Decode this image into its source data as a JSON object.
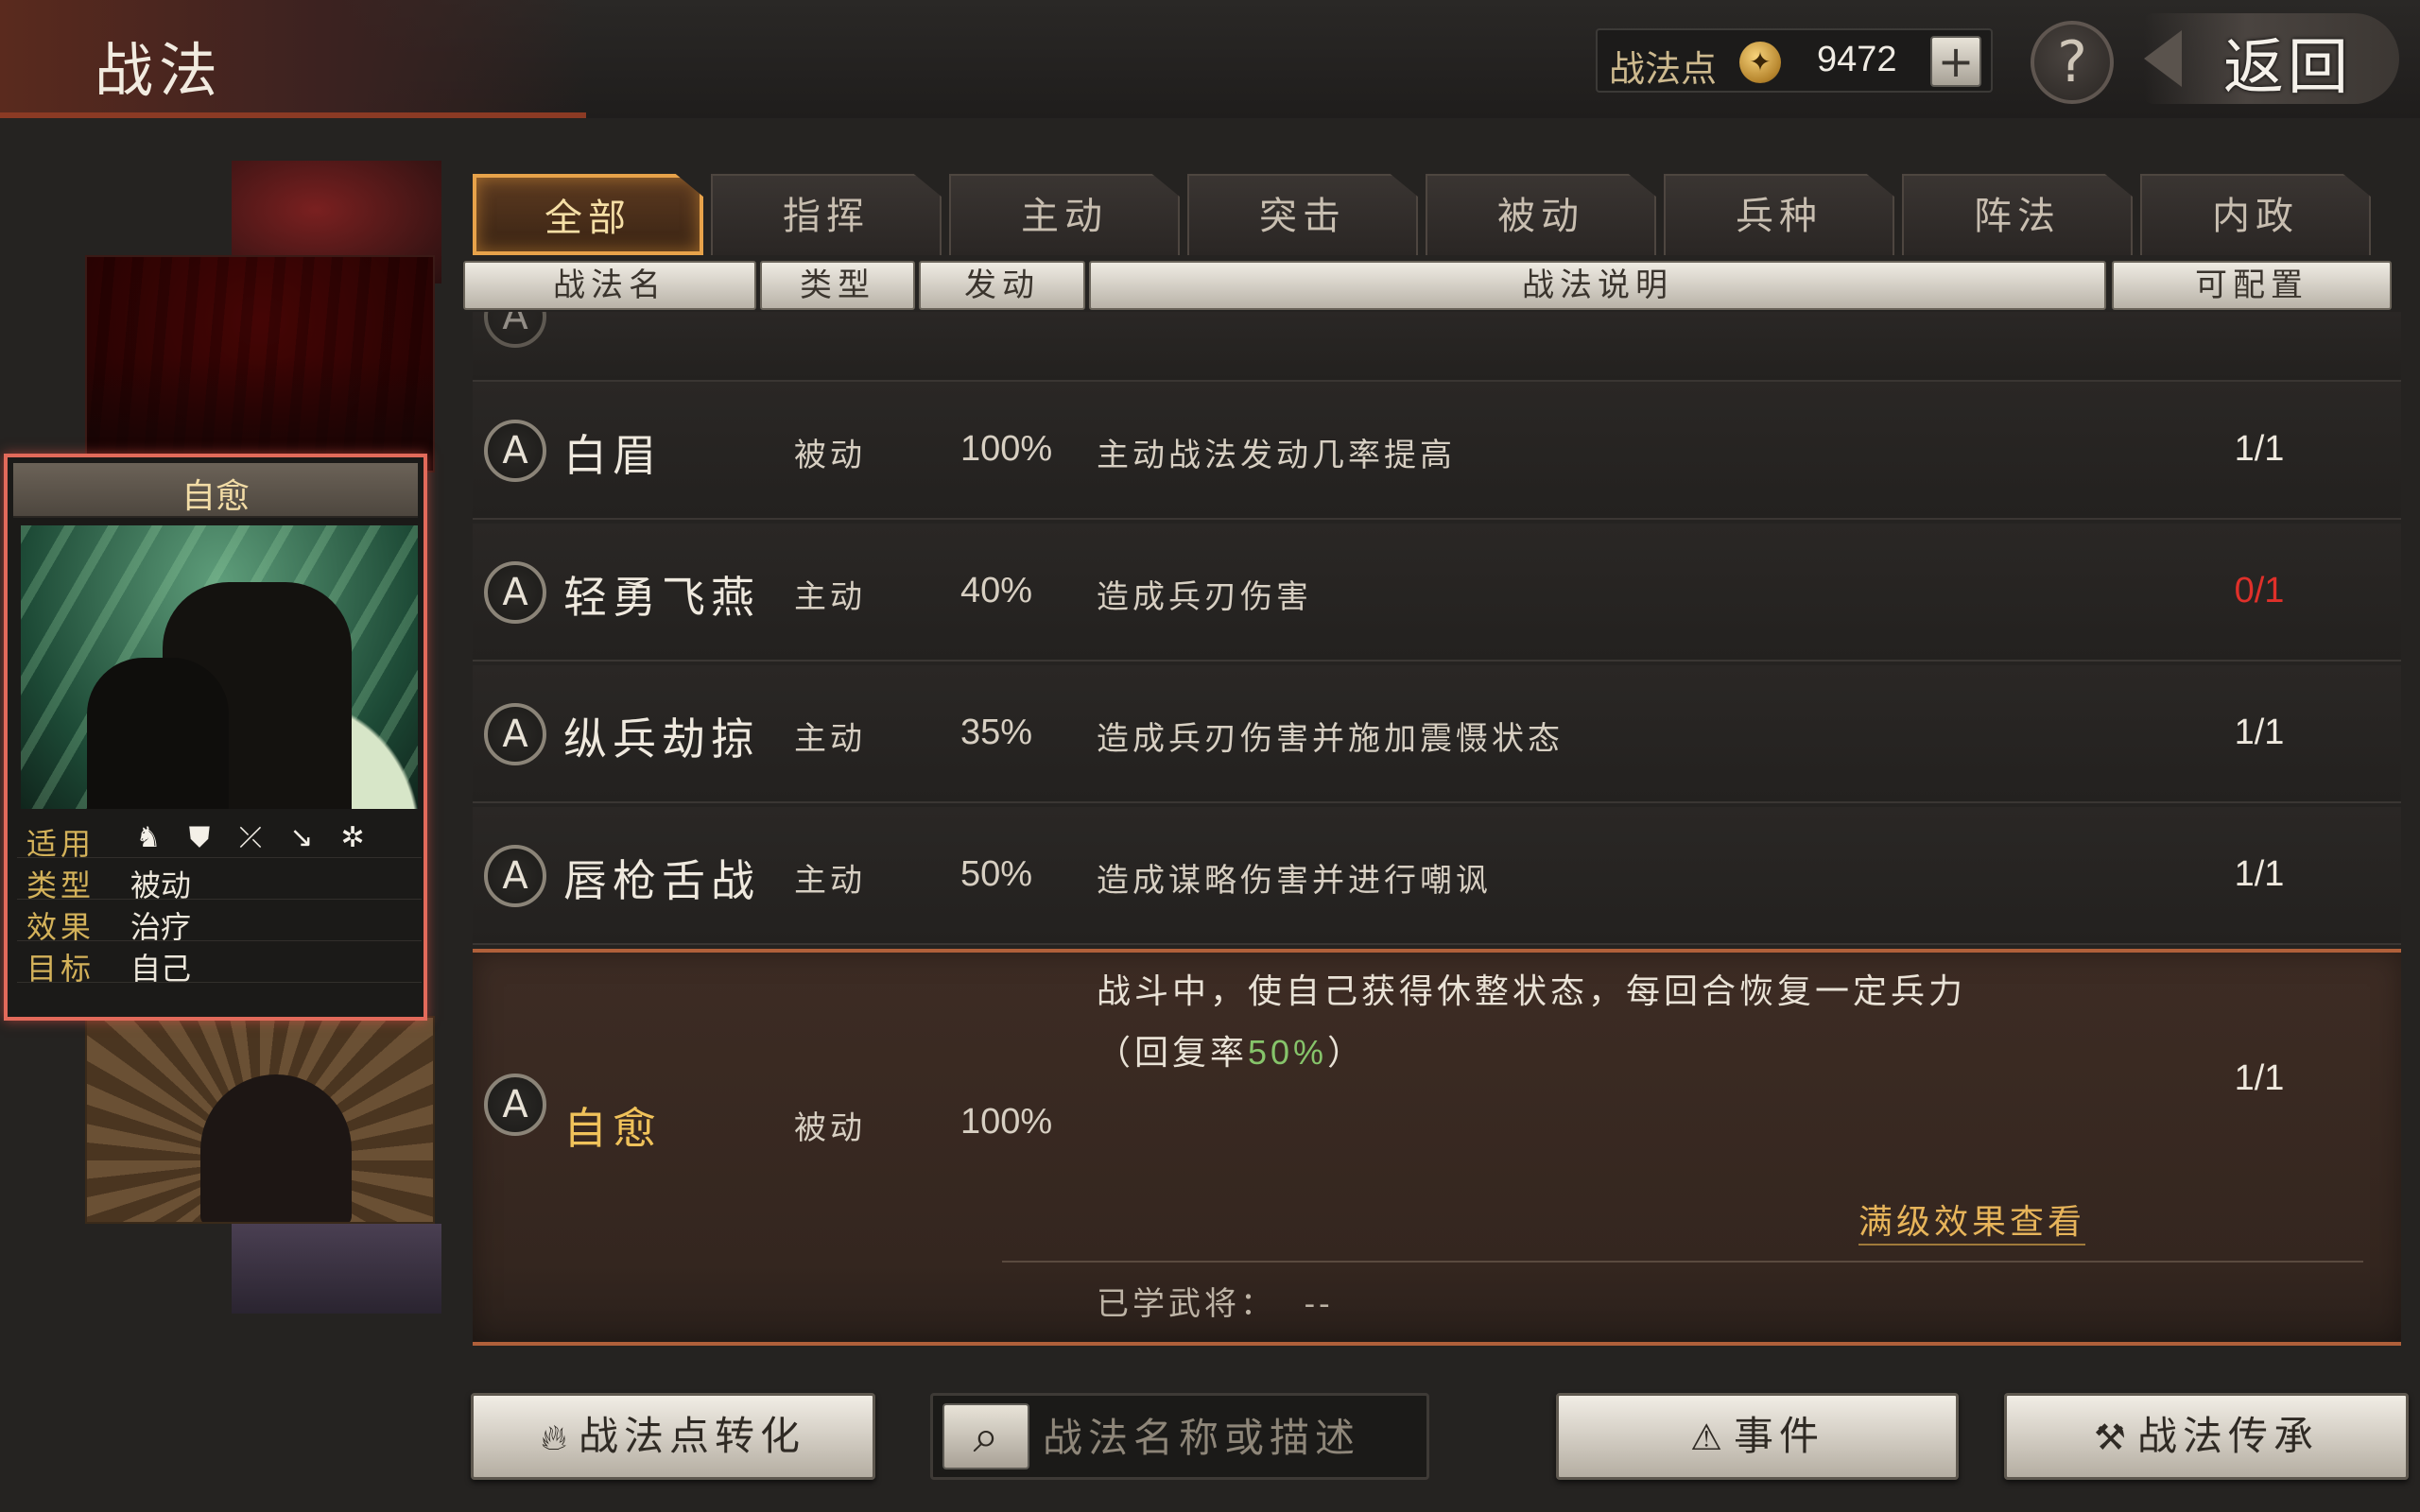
{
  "header": {
    "title": "战法",
    "points_label": "战法点",
    "points_value": "9472",
    "plus_icon": "plus-icon",
    "help_label": "?",
    "back_label": "返回"
  },
  "tabs": [
    {
      "label": "全部",
      "active": true
    },
    {
      "label": "指挥",
      "active": false
    },
    {
      "label": "主动",
      "active": false
    },
    {
      "label": "突击",
      "active": false
    },
    {
      "label": "被动",
      "active": false
    },
    {
      "label": "兵种",
      "active": false
    },
    {
      "label": "阵法",
      "active": false
    },
    {
      "label": "内政",
      "active": false
    }
  ],
  "columns": {
    "name": "战法名",
    "type": "类型",
    "rate": "发动",
    "desc": "战法说明",
    "count": "可配置"
  },
  "rows": [
    {
      "grade": "A",
      "name": "白眉",
      "type": "被动",
      "rate": "100%",
      "desc": "主动战法发动几率提高",
      "count": "1/1",
      "count_red": false
    },
    {
      "grade": "A",
      "name": "轻勇飞燕",
      "type": "主动",
      "rate": "40%",
      "desc": "造成兵刃伤害",
      "count": "0/1",
      "count_red": true
    },
    {
      "grade": "A",
      "name": "纵兵劫掠",
      "type": "主动",
      "rate": "35%",
      "desc": "造成兵刃伤害并施加震慑状态",
      "count": "1/1",
      "count_red": false
    },
    {
      "grade": "A",
      "name": "唇枪舌战",
      "type": "主动",
      "rate": "50%",
      "desc": "造成谋略伤害并进行嘲讽",
      "count": "1/1",
      "count_red": false
    }
  ],
  "expanded": {
    "grade": "A",
    "name": "自愈",
    "type": "被动",
    "rate": "100%",
    "desc_line1": "战斗中，使自己获得休整状态，每回合恢复一定兵力",
    "desc_line2_prefix": "（回复率",
    "desc_line2_value": "50%",
    "desc_line2_suffix": "）",
    "count": "1/1",
    "full_effect_link": "满级效果查看",
    "learned_label": "已学武将：",
    "learned_value": "--"
  },
  "card": {
    "title": "自愈",
    "applies_label": "适用",
    "unit_icons": [
      "cavalry-icon",
      "shield-icon",
      "bow-icon",
      "spear-icon",
      "wheel-icon"
    ],
    "type_label": "类型",
    "type_value": "被动",
    "effect_label": "效果",
    "effect_value": "治疗",
    "target_label": "目标",
    "target_value": "自己"
  },
  "bottom": {
    "convert_label": "战法点转化",
    "search_placeholder": "战法名称或描述",
    "event_label": "事件",
    "inherit_label": "战法传承"
  },
  "colors": {
    "accent_gold": "#e7a24a",
    "highlight_green": "#86c46a",
    "warning_red": "#e0302a",
    "card_border": "#e26a5a"
  }
}
